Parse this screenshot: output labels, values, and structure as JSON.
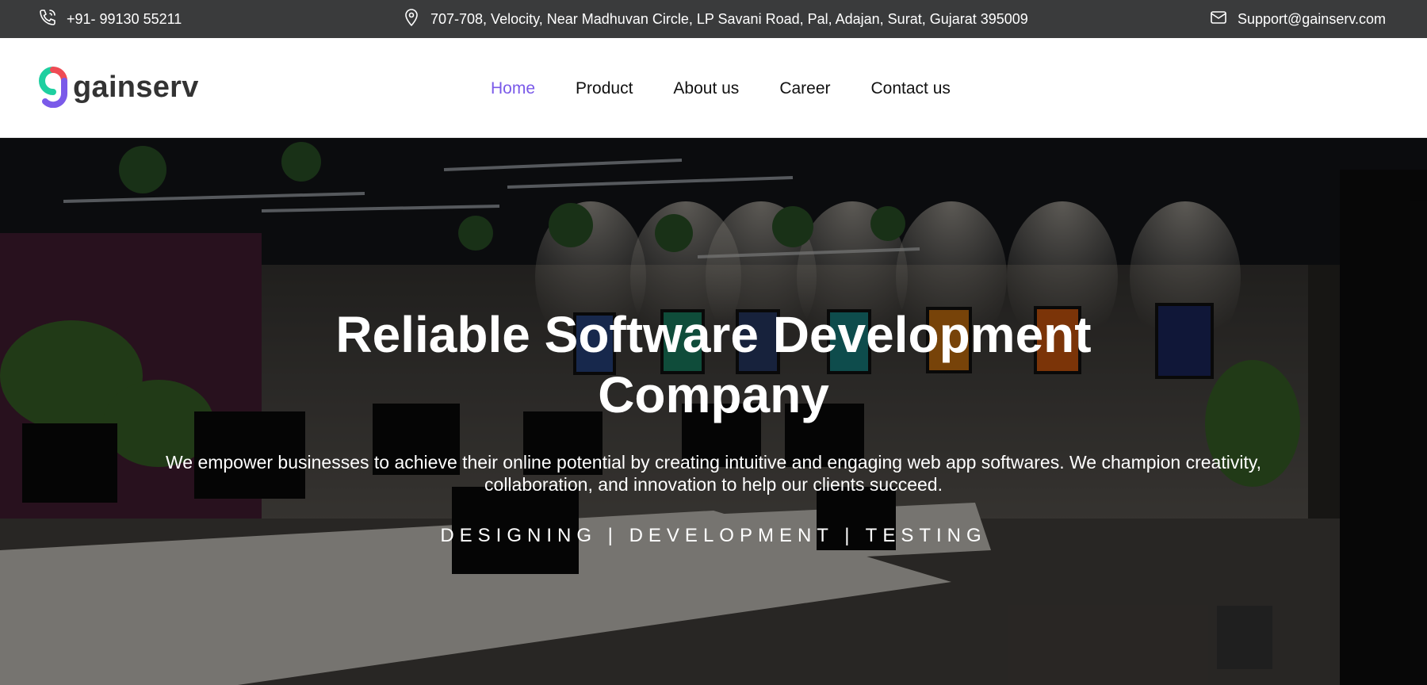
{
  "topbar": {
    "phone": "+91- 99130 55211",
    "address": "707-708, Velocity, Near Madhuvan Circle, LP Savani Road, Pal, Adajan, Surat, Gujarat 395009",
    "email": "Support@gainserv.com",
    "icons": [
      "phone-icon",
      "location-pin-icon",
      "mail-icon"
    ],
    "background": "#3a3b3c"
  },
  "brand": {
    "name": "gainserv",
    "colors": [
      "#1ecfa0",
      "#ef4b54",
      "#7a5ae9"
    ]
  },
  "nav": {
    "items": [
      {
        "label": "Home",
        "active": true
      },
      {
        "label": "Product",
        "active": false
      },
      {
        "label": "About us",
        "active": false
      },
      {
        "label": "Career",
        "active": false
      },
      {
        "label": "Contact us",
        "active": false
      }
    ],
    "active_color": "#7a5ae9"
  },
  "hero": {
    "title_line1": "Reliable Software Development",
    "title_line2": "Company",
    "description": "We empower businesses to achieve their online potential by creating intuitive and engaging web app softwares. We champion creativity, collaboration, and innovation to help our clients succeed.",
    "tagline": "DESIGNING | DEVELOPMENT | TESTING"
  }
}
